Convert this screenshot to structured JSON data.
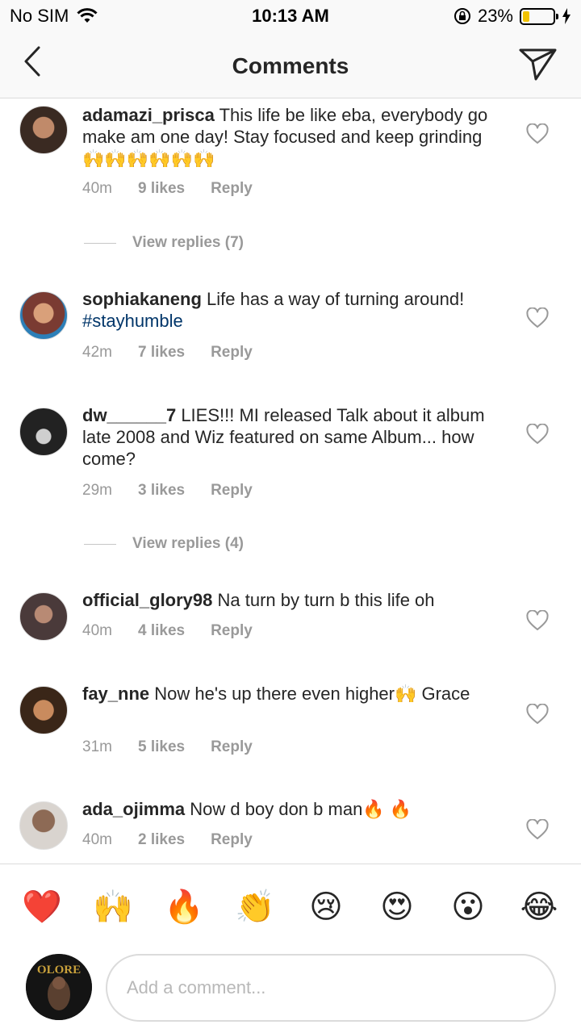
{
  "status_bar": {
    "carrier": "No SIM",
    "time": "10:13 AM",
    "battery": "23%",
    "battery_level": 0.23,
    "battery_color": "#f2c200"
  },
  "nav": {
    "title": "Comments",
    "back_icon": "chevron-left-icon",
    "share_icon": "paper-plane-icon"
  },
  "comments": [
    {
      "username": "adamazi_prisca",
      "text": " This life be like eba, everybody go make am one day! Stay focused and keep grinding🙌🙌🙌🙌🙌🙌",
      "time": "40m",
      "likes": "9 likes",
      "reply": "Reply",
      "view_replies": "View replies (7)"
    },
    {
      "username": "sophiakaneng",
      "text": " Life has a way of turning around! ",
      "hashtag": "#stayhumble",
      "time": "42m",
      "likes": "7 likes",
      "reply": "Reply"
    },
    {
      "username": "dw______7",
      "text": " LIES!!! MI released Talk about it album late 2008 and Wiz featured on same Album... how come?",
      "time": "29m",
      "likes": "3 likes",
      "reply": "Reply",
      "view_replies": "View replies (4)"
    },
    {
      "username": "official_glory98",
      "text": " Na turn by turn b this life oh",
      "time": "40m",
      "likes": "4 likes",
      "reply": "Reply"
    },
    {
      "username": "fay_nne",
      "text": " Now he's up there even higher🙌 Grace",
      "time": "31m",
      "likes": "5 likes",
      "reply": "Reply"
    },
    {
      "username": "ada_ojimma",
      "text": " Now d boy don b man🔥 🔥",
      "time": "40m",
      "likes": "2 likes",
      "reply": "Reply"
    }
  ],
  "emoji_bar": [
    "❤️",
    "🙌",
    "🔥",
    "👏",
    "😢",
    "😍",
    "😮",
    "😂"
  ],
  "composer": {
    "placeholder": "Add a comment...",
    "avatar_text": "OLORE"
  }
}
